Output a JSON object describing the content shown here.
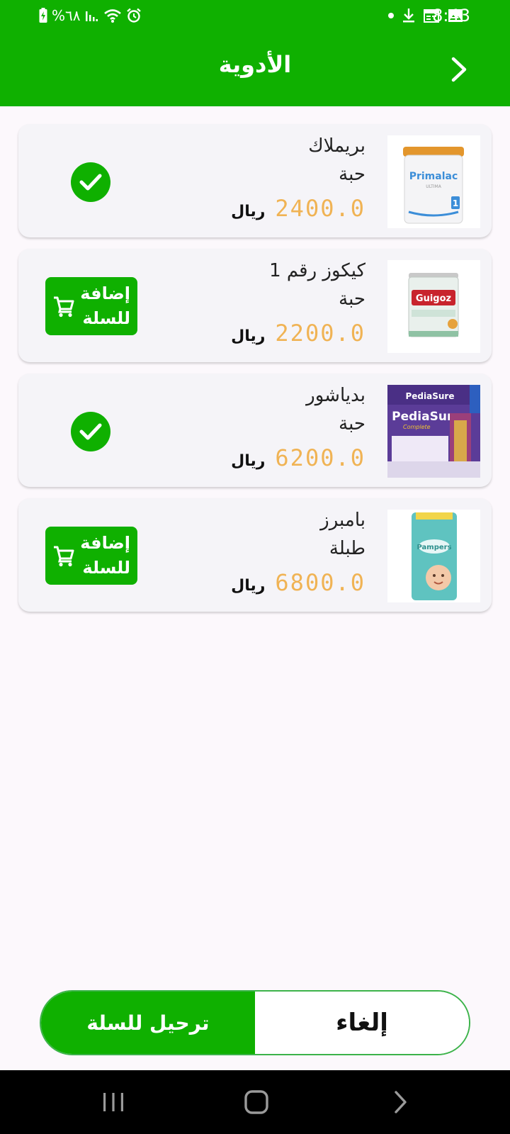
{
  "status_bar": {
    "battery_percent": "%٦٨",
    "time": "8:43",
    "icons": [
      "battery-charging-icon",
      "signal-icon",
      "wifi-icon",
      "alarm-icon",
      "dot-icon",
      "download-icon",
      "calendar-icon",
      "image-icon"
    ]
  },
  "header": {
    "title": "الأدوية",
    "back_icon": "chevron-right-icon"
  },
  "products": [
    {
      "name": "بريملاك",
      "unit": "حبة",
      "price": "2400.0",
      "currency": "ريال",
      "in_cart": true,
      "image": "primalac-can"
    },
    {
      "name": "كيكوز رقم 1",
      "unit": "حبة",
      "price": "2200.0",
      "currency": "ريال",
      "in_cart": false,
      "image": "guigoz-can"
    },
    {
      "name": "بدياشور",
      "unit": "حبة",
      "price": "6200.0",
      "currency": "ريال",
      "in_cart": true,
      "image": "pediasure-box"
    },
    {
      "name": "بامبرز",
      "unit": "طبلة",
      "price": "6800.0",
      "currency": "ريال",
      "in_cart": false,
      "image": "pampers-pack"
    }
  ],
  "add_to_cart": {
    "line1": "إضافة",
    "line2": "للسلة",
    "icon": "cart-icon"
  },
  "footer": {
    "move_to_cart_label": "ترحيل للسلة",
    "cancel_label": "إلغاء"
  },
  "colors": {
    "brand_green": "#0fb000",
    "price_orange": "#f0b354",
    "card_bg": "#f5f4f8"
  },
  "nav_bar": {
    "icons": [
      "recents-icon",
      "home-icon",
      "back-icon"
    ]
  }
}
